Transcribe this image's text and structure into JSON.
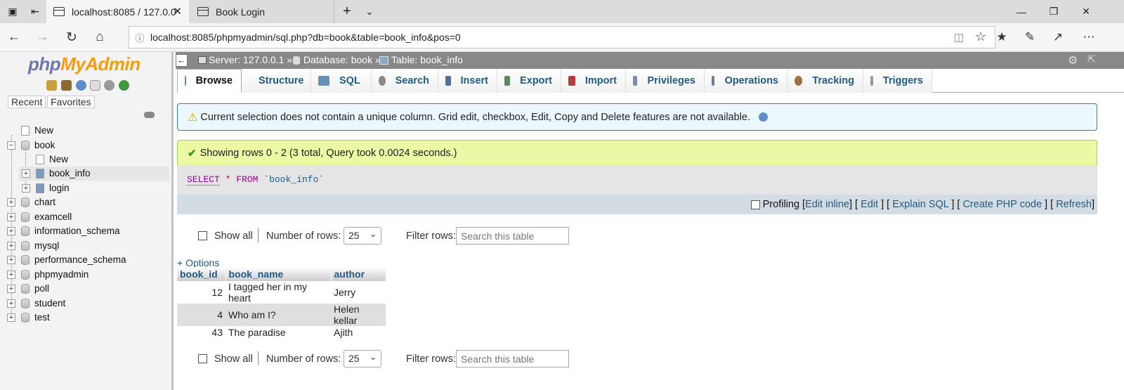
{
  "browser": {
    "tabs": [
      {
        "title": "localhost:8085 / 127.0.0"
      },
      {
        "title": "Book Login"
      }
    ],
    "url": "localhost:8085/phpmyadmin/sql.php?db=book&table=book_info&pos=0"
  },
  "sidebar": {
    "logo_php": "php",
    "logo_myadmin": "MyAdmin",
    "recent_label": "Recent",
    "favorites_label": "Favorites",
    "tree": [
      {
        "label": "New"
      },
      {
        "label": "book"
      },
      {
        "label": "New"
      },
      {
        "label": "book_info"
      },
      {
        "label": "login"
      },
      {
        "label": "chart"
      },
      {
        "label": "examcell"
      },
      {
        "label": "information_schema"
      },
      {
        "label": "mysql"
      },
      {
        "label": "performance_schema"
      },
      {
        "label": "phpmyadmin"
      },
      {
        "label": "poll"
      },
      {
        "label": "student"
      },
      {
        "label": "test"
      }
    ]
  },
  "breadcrumb": {
    "server": "Server: 127.0.0.1 »",
    "database": "Database: book »",
    "table": "Table: book_info"
  },
  "main_tabs": [
    {
      "label": "Browse",
      "icon": "browse-icon",
      "color": "#5b8fc7"
    },
    {
      "label": "Structure",
      "icon": "structure-icon",
      "color": "#4a7ab5"
    },
    {
      "label": "SQL",
      "icon": "sql-icon",
      "color": "#6a8fb8"
    },
    {
      "label": "Search",
      "icon": "search-icon",
      "color": "#888888"
    },
    {
      "label": "Insert",
      "icon": "insert-icon",
      "color": "#4c6fa0"
    },
    {
      "label": "Export",
      "icon": "export-icon",
      "color": "#5d8a5d"
    },
    {
      "label": "Import",
      "icon": "import-icon",
      "color": "#b04040"
    },
    {
      "label": "Privileges",
      "icon": "privileges-icon",
      "color": "#7a8fb0"
    },
    {
      "label": "Operations",
      "icon": "wrench-icon",
      "color": "#6a7fa0"
    },
    {
      "label": "Tracking",
      "icon": "eye-icon",
      "color": "#a07040"
    },
    {
      "label": "Triggers",
      "icon": "triggers-icon",
      "color": "#999999"
    }
  ],
  "notice": {
    "text": "Current selection does not contain a unique column. Grid edit, checkbox, Edit, Copy and Delete features are not available."
  },
  "success": {
    "text": "Showing rows 0 - 2 (3 total, Query took 0.0024 seconds.)"
  },
  "sql": {
    "select": "SELECT",
    "star": "*",
    "from": "FROM",
    "table": "`book_info`"
  },
  "sql_actions": {
    "profiling": "Profiling",
    "links": [
      "Edit inline",
      "Edit",
      "Explain SQL",
      "Create PHP code",
      "Refresh"
    ]
  },
  "nav": {
    "show_all": "Show all",
    "number_of_rows": "Number of rows:",
    "rows_value": "25",
    "filter_rows": "Filter rows:",
    "filter_placeholder": "Search this table"
  },
  "options_label": "+ Options",
  "table": {
    "columns": [
      "book_id",
      "book_name",
      "author"
    ],
    "rows": [
      [
        "12",
        "I tagged her in my heart",
        "Jerry"
      ],
      [
        "4",
        "Who am I?",
        "Helen kellar"
      ],
      [
        "43",
        "The paradise",
        "Ajith"
      ]
    ]
  }
}
